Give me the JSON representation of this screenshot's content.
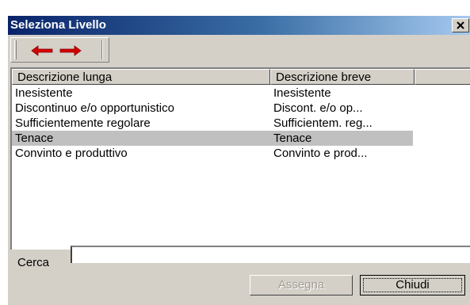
{
  "window": {
    "title": "Seleziona Livello",
    "close_icon": "close-x-icon"
  },
  "toolbar": {
    "prev_icon": "red-arrow-left-icon",
    "next_icon": "red-arrow-right-icon",
    "arrow_color": "#d40000"
  },
  "list": {
    "columns": [
      "Descrizione lunga",
      "Descrizione breve",
      ""
    ],
    "rows": [
      {
        "long": "Inesistente",
        "short": "Inesistente"
      },
      {
        "long": "Discontinuo e/o opportunistico",
        "short": "Discont. e/o op..."
      },
      {
        "long": "Sufficientemente regolare",
        "short": "Sufficientem. reg..."
      },
      {
        "long": "Tenace",
        "short": "Tenace"
      },
      {
        "long": "Convinto e produttivo",
        "short": "Convinto e prod..."
      }
    ],
    "selected_row": 3
  },
  "search": {
    "label": "Cerca",
    "value": ""
  },
  "buttons": {
    "assign": "Assegna",
    "close": "Chiudi"
  }
}
